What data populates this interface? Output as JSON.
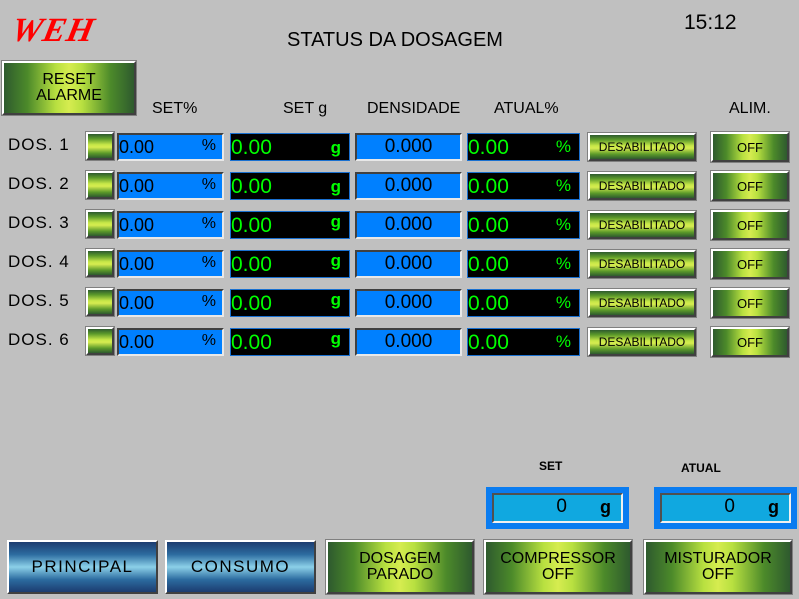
{
  "header": {
    "logo": "WEH",
    "title": "STATUS DA DOSAGEM",
    "clock": "15:12"
  },
  "reset_button": {
    "line1": "RESET",
    "line2": "ALARME"
  },
  "columns": {
    "set_pct": "SET%",
    "set_g": "SET g",
    "densidade": "DENSIDADE",
    "atual_pct": "ATUAL%",
    "alim": "ALIM."
  },
  "dosers": [
    {
      "label": "DOS. 1",
      "set_pct": "0.00",
      "set_pct_unit": "%",
      "set_g": "0.00",
      "set_g_unit": "g",
      "densidade": "0.000",
      "atual_pct": "0.00",
      "atual_unit": "%",
      "status": "DESABILITADO",
      "alim": "OFF"
    },
    {
      "label": "DOS. 2",
      "set_pct": "0.00",
      "set_pct_unit": "%",
      "set_g": "0.00",
      "set_g_unit": "g",
      "densidade": "0.000",
      "atual_pct": "0.00",
      "atual_unit": "%",
      "status": "DESABILITADO",
      "alim": "OFF"
    },
    {
      "label": "DOS. 3",
      "set_pct": "0.00",
      "set_pct_unit": "%",
      "set_g": "0.00",
      "set_g_unit": "g",
      "densidade": "0.000",
      "atual_pct": "0.00",
      "atual_unit": "%",
      "status": "DESABILITADO",
      "alim": "OFF"
    },
    {
      "label": "DOS. 4",
      "set_pct": "0.00",
      "set_pct_unit": "%",
      "set_g": "0.00",
      "set_g_unit": "g",
      "densidade": "0.000",
      "atual_pct": "0.00",
      "atual_unit": "%",
      "status": "DESABILITADO",
      "alim": "OFF"
    },
    {
      "label": "DOS. 5",
      "set_pct": "0.00",
      "set_pct_unit": "%",
      "set_g": "0.00",
      "set_g_unit": "g",
      "densidade": "0.000",
      "atual_pct": "0.00",
      "atual_unit": "%",
      "status": "DESABILITADO",
      "alim": "OFF"
    },
    {
      "label": "DOS. 6",
      "set_pct": "0.00",
      "set_pct_unit": "%",
      "set_g": "0.00",
      "set_g_unit": "g",
      "densidade": "0.000",
      "atual_pct": "0.00",
      "atual_unit": "%",
      "status": "DESABILITADO",
      "alim": "OFF"
    }
  ],
  "totals": {
    "set_label": "SET",
    "set_value": "0",
    "set_unit": "g",
    "atual_label": "ATUAL",
    "atual_value": "0",
    "atual_unit": "g"
  },
  "nav": {
    "principal": "PRINCIPAL",
    "consumo": "CONSUMO",
    "dosagem_line1": "DOSAGEM",
    "dosagem_line2": "PARADO",
    "compressor_line1": "COMPRESSOR",
    "compressor_line2": "OFF",
    "misturador_line1": "MISTURADOR",
    "misturador_line2": "OFF"
  }
}
